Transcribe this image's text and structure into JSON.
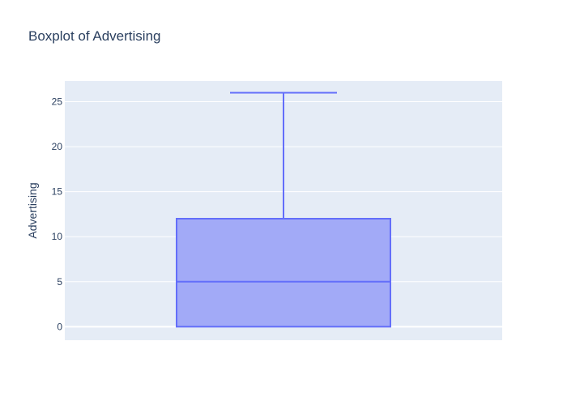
{
  "chart_data": {
    "type": "box",
    "title": "Boxplot of Advertising",
    "xlabel": "",
    "ylabel": "Advertising",
    "ylim": [
      -1.5,
      27.3
    ],
    "yticks": [
      0,
      5,
      10,
      15,
      20,
      25
    ],
    "grid": true,
    "series": [
      {
        "min": 0,
        "q1": 0,
        "median": 5,
        "q3": 12,
        "max": 26,
        "color": "#636efa",
        "fill": "#a2aaf7"
      }
    ]
  },
  "colors": {
    "plot_bg": "#e5ecf6",
    "grid": "#ffffff",
    "text": "#2a3f5f"
  }
}
